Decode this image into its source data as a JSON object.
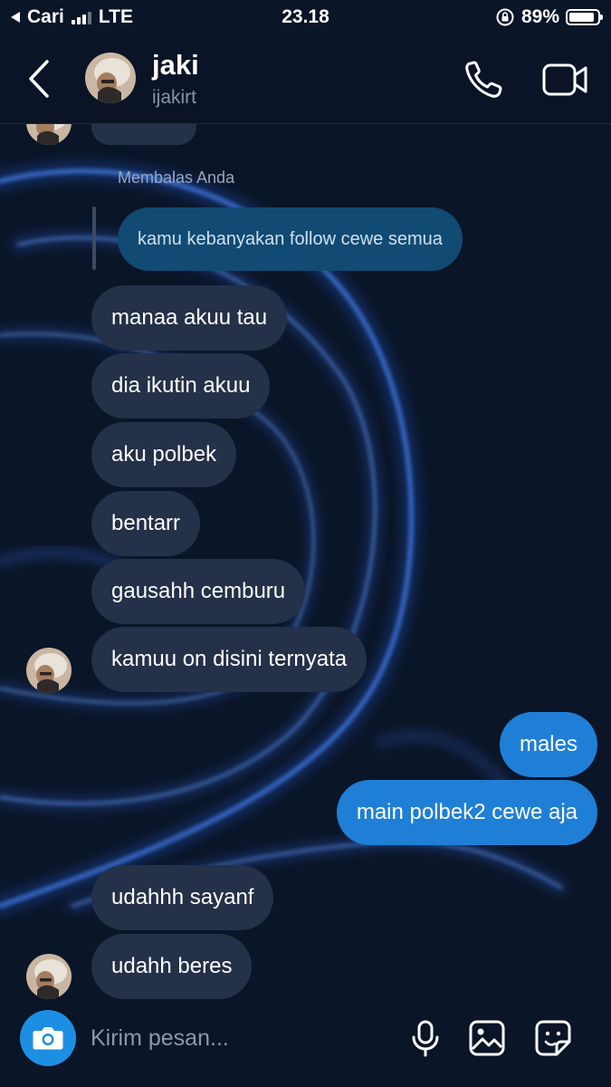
{
  "status_bar": {
    "carrier": "Cari",
    "network": "LTE",
    "time": "23.18",
    "battery": "89%",
    "battery_level": 0.89
  },
  "header": {
    "name": "jaki",
    "username": "ijakirt"
  },
  "reply": {
    "label": "Membalas Anda",
    "quoted_text": "kamu kebanyakan follow cewe semua"
  },
  "messages": [
    {
      "from": "them",
      "text": "manaa akuu tau"
    },
    {
      "from": "them",
      "text": "dia ikutin akuu"
    },
    {
      "from": "them",
      "text": "aku polbek"
    },
    {
      "from": "them",
      "text": "bentarr"
    },
    {
      "from": "them",
      "text": "gausahh cemburu"
    },
    {
      "from": "them",
      "text": "kamuu on disini ternyata"
    },
    {
      "from": "me",
      "text": "males"
    },
    {
      "from": "me",
      "text": "main polbek2 cewe aja"
    },
    {
      "from": "them",
      "text": "udahhh sayanf"
    },
    {
      "from": "them",
      "text": "udahh beres"
    }
  ],
  "composer": {
    "placeholder": "Kirim pesan..."
  },
  "colors": {
    "background": "#0b1528",
    "incoming_bubble": "#253049",
    "outgoing_bubble": "#1f7fd6",
    "reply_bubble": "#114a72",
    "camera_button": "#1d8fe3"
  },
  "icons": {
    "back": "chevron-left-icon",
    "call": "phone-icon",
    "video": "video-camera-icon",
    "camera": "camera-icon",
    "mic": "microphone-icon",
    "gallery": "image-icon",
    "sticker": "sticker-icon"
  }
}
